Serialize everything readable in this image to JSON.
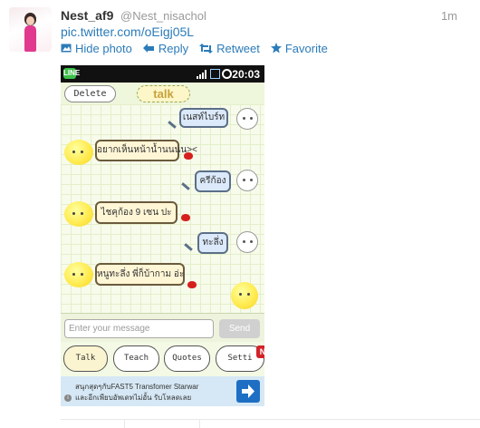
{
  "tweet": {
    "author": "Nest_af9",
    "handle": "@Nest_nisachol",
    "time": "1m",
    "link": "pic.twitter.com/oEigj05L"
  },
  "actions": {
    "hide_photo": "Hide photo",
    "reply": "Reply",
    "retweet": "Retweet",
    "favorite": "Favorite"
  },
  "photo": {
    "status_clock": "20:03",
    "app_logo": "LINE",
    "delete_label": "Delete",
    "talk_title": "talk",
    "messages": [
      {
        "text": "เนสท์ไบร์ท",
        "side": "out"
      },
      {
        "text": "อยากเห็นหน้าน้ำนนนน><",
        "side": "in"
      },
      {
        "text": "ครีก้อง",
        "side": "out"
      },
      {
        "text": "ไชคุก้อง 9 เซน ปะ",
        "side": "in"
      },
      {
        "text": "ทะลึ่ง",
        "side": "out"
      },
      {
        "text": "หนูทะลึ่ง พี่ก็บ้ากาม อ่ะ",
        "side": "in"
      }
    ],
    "input_placeholder": "Enter your message",
    "send_label": "Send",
    "tabs": [
      "Talk",
      "Teach",
      "Quotes",
      "Setti"
    ],
    "new_badge": "N",
    "ad_line1": "สนุกสุดๆกับFAST5 Transfomer Starwar",
    "ad_line2": "และอีกเพียบอัพเดทไม่อั้น รับโหลดเลย",
    "ad_info": "i"
  }
}
